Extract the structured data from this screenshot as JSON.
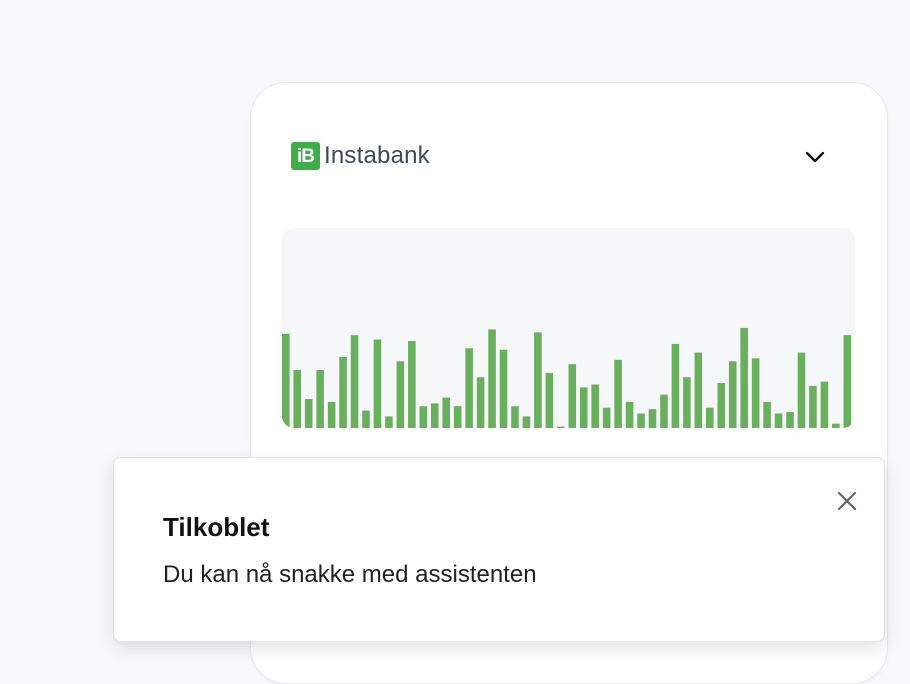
{
  "card": {
    "brand": {
      "name": "Instabank",
      "logo_icon": "instabank-logo-icon",
      "brand_color": "#3fae49",
      "text_color": "#3d4a5c"
    },
    "expand_icon": "chevron-down-icon"
  },
  "chart_data": {
    "type": "bar",
    "color": "#6aaf5e",
    "ylim": [
      0,
      100
    ],
    "values": [
      65,
      40,
      20,
      40,
      18,
      49,
      64,
      12,
      61,
      8,
      46,
      60,
      15,
      17,
      21,
      15,
      55,
      35,
      68,
      54,
      15,
      8,
      66,
      38,
      1,
      44,
      28,
      30,
      14,
      47,
      18,
      10,
      13,
      23,
      58,
      35,
      52,
      14,
      31,
      46,
      69,
      48,
      18,
      10,
      11,
      52,
      29,
      32,
      3,
      64
    ]
  },
  "toast": {
    "title": "Tilkoblet",
    "message": "Du kan nå snakke med assistenten",
    "close_icon": "close-icon"
  }
}
